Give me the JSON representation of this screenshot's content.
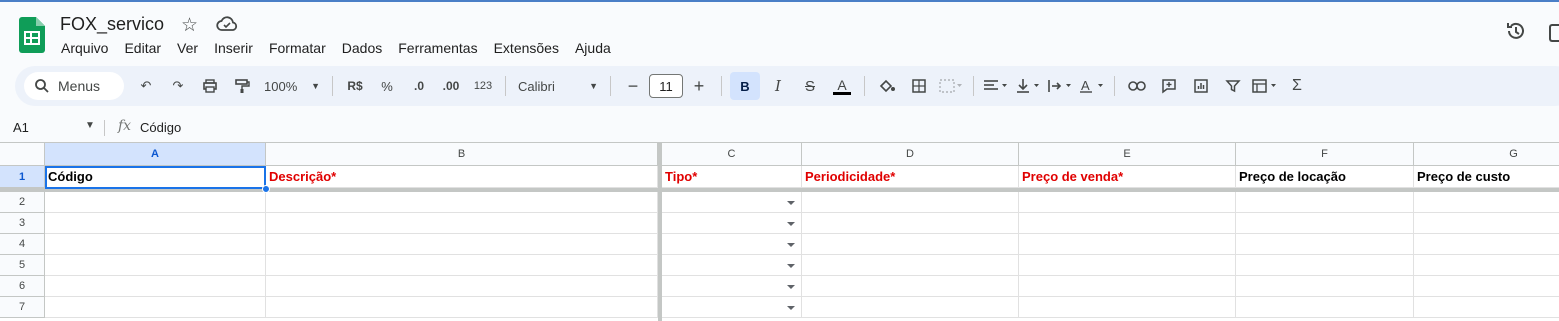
{
  "app": {
    "title": "FOX_servico",
    "menu": [
      "Arquivo",
      "Editar",
      "Ver",
      "Inserir",
      "Formatar",
      "Dados",
      "Ferramentas",
      "Extensões",
      "Ajuda"
    ]
  },
  "toolbar": {
    "search_label": "Menus",
    "zoom": "100%",
    "currency": "R$",
    "percent": "%",
    "decrease_decimals": ".0",
    "increase_decimals": ".00",
    "number_format": "123",
    "font": "Calibri",
    "font_size": "11",
    "bold": "B",
    "italic": "I"
  },
  "formula_bar": {
    "cell_ref": "A1",
    "fx": "fx",
    "value": "Código"
  },
  "sheet": {
    "columns": [
      "A",
      "B",
      "C",
      "D",
      "E",
      "F",
      "G"
    ],
    "rows": [
      "1",
      "2",
      "3",
      "4",
      "5",
      "6",
      "7"
    ],
    "header_cells": [
      {
        "text": "Código",
        "color": "#000000"
      },
      {
        "text": "Descrição*",
        "color": "#e00000"
      },
      {
        "text": "Tipo*",
        "color": "#e00000"
      },
      {
        "text": "Periodicidade*",
        "color": "#e00000"
      },
      {
        "text": "Preço de venda*",
        "color": "#e00000"
      },
      {
        "text": "Preço de locação",
        "color": "#000000"
      },
      {
        "text": "Preço de custo",
        "color": "#000000"
      }
    ]
  },
  "colors": {
    "accent": "#1a73e8",
    "required_header": "#e00000",
    "selected_header_bg": "#d3e3fd"
  }
}
